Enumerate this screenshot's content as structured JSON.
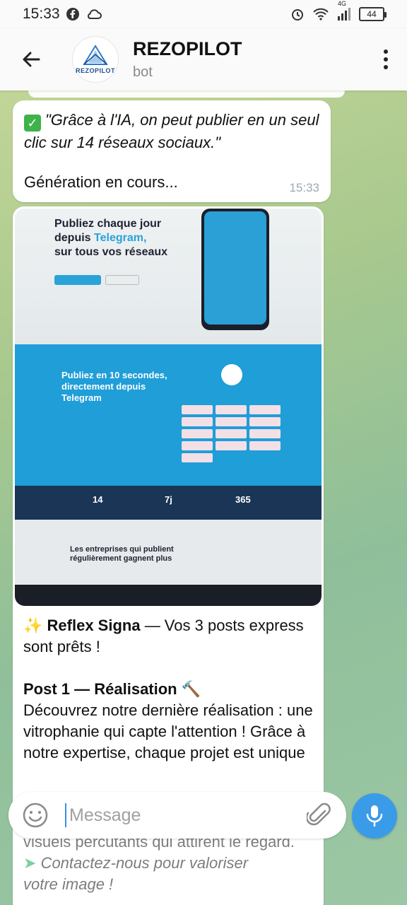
{
  "status_bar": {
    "time": "15:33",
    "network_label": "4G",
    "battery": "44",
    "icons": [
      "facebook-icon",
      "cloud-icon",
      "alarm-icon",
      "wifi-icon",
      "signal-icon",
      "battery-icon"
    ]
  },
  "header": {
    "title": "REZOPILOT",
    "subtitle": "bot",
    "avatar_text": "REZOPILOT"
  },
  "messages": [
    {
      "quote": "\"Grâce à l'IA, on peut publier en un seul clic sur 14 réseaux sociaux.\"",
      "status": "Génération en cours...",
      "time": "15:33"
    },
    {
      "photo": {
        "headline_1": "Publiez chaque jour",
        "headline_2": "depuis",
        "headline_2_accent": "Telegram,",
        "headline_3": "sur tous vos réseaux",
        "section_title": "Publiez en 10 secondes, directement depuis Telegram",
        "stat_1": "14",
        "stat_2": "7j",
        "stat_3": "365",
        "bottom_title": "Les entreprises qui publient régulièrement gagnent plus"
      },
      "caption": {
        "intro_bold": "Reflex Signa",
        "intro_rest": " — Vos 3 posts express sont prêts !",
        "post_title": "Post 1 — Réalisation",
        "post_body": "Découvrez notre dernière réalisation : une vitrophanie qui capte l'attention ! Grâce à notre expertise, chaque projet est unique",
        "under_1": "visuels percutants qui attirent le regard.",
        "under_2": "Contactez-nous pour valoriser",
        "under_3": "votre image !"
      }
    }
  ],
  "composer": {
    "placeholder": "Message"
  },
  "colors": {
    "accent": "#3a9be8",
    "check": "#3fb24a",
    "time_text": "#a0a8b0"
  }
}
